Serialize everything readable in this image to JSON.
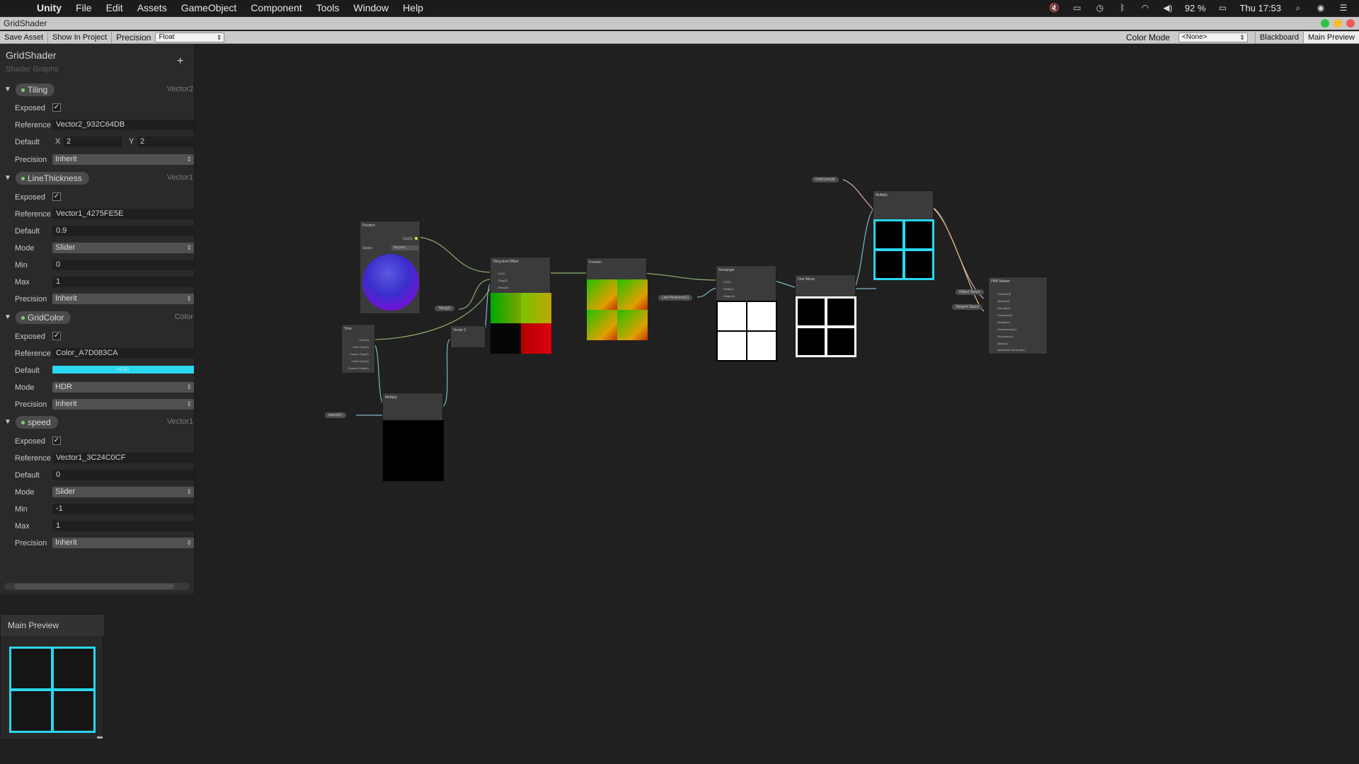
{
  "macos": {
    "app_name": "Unity",
    "menus": [
      "File",
      "Edit",
      "Assets",
      "GameObject",
      "Component",
      "Tools",
      "Window",
      "Help"
    ],
    "battery": "92 %",
    "clock": "Thu 17:53"
  },
  "window": {
    "title": "GridShader"
  },
  "toolbar": {
    "save_asset": "Save Asset",
    "show_in_project": "Show In Project",
    "precision_label": "Precision",
    "precision_value": "Float",
    "color_mode_label": "Color Mode",
    "color_mode_value": "<None>",
    "blackboard": "Blackboard",
    "main_preview": "Main Preview"
  },
  "blackboard": {
    "title": "GridShader",
    "subtitle": "Shader Graphs",
    "add_glyph": "+",
    "labels": {
      "exposed": "Exposed",
      "reference": "Reference",
      "default": "Default",
      "precision": "Precision",
      "mode": "Mode",
      "min": "Min",
      "max": "Max",
      "x": "X",
      "y": "Y"
    },
    "properties": [
      {
        "name": "Tiling",
        "type": "Vector2",
        "reference": "Vector2_932C64DB",
        "default_x": "2",
        "default_y": "2",
        "precision": "Inherit"
      },
      {
        "name": "LineThickness",
        "type": "Vector1",
        "reference": "Vector1_4275FE5E",
        "default": "0.9",
        "mode": "Slider",
        "min": "0",
        "max": "1",
        "precision": "Inherit"
      },
      {
        "name": "GridColor",
        "type": "Color",
        "reference": "Color_A7D083CA",
        "default_label": "HDR",
        "mode": "HDR",
        "precision": "Inherit"
      },
      {
        "name": "speed",
        "type": "Vector1",
        "reference": "Vector1_3C24C0CF",
        "default": "0",
        "mode": "Slider",
        "min": "-1",
        "max": "1",
        "precision": "Inherit"
      }
    ]
  },
  "main_preview": {
    "title": "Main Preview"
  },
  "graph": {
    "nodes": {
      "position": "Position",
      "position_out": "Out(3)",
      "position_space": "Space",
      "position_space_value": "Tangent",
      "time": "Time",
      "time_outputs": [
        "Time(1)",
        "Sine Time(1)",
        "Cosine Time(1)",
        "Delta Time(1)",
        "Smooth Delta(1)"
      ],
      "vector2": "Vector 2",
      "multiply_small": "Multiply",
      "tiling_offset": "Tiling And Offset",
      "tiling_offset_inputs": [
        "UV(2)",
        "Tiling(2)",
        "Offset(2)"
      ],
      "fraction": "Fraction",
      "rectangle": "Rectangle",
      "rectangle_inputs": [
        "UV(2)",
        "Width(1)",
        "Height(1)"
      ],
      "one_minus": "One Minus",
      "multiply_top": "Multiply",
      "pbr": "PBR Master",
      "pbr_inputs": [
        "Position(3)",
        "Albedo(3)",
        "Normal(3)",
        "Emission(3)",
        "Metallic(1)",
        "Smoothness(1)",
        "Occlusion(1)",
        "Alpha(1)",
        "AlphaClipThreshold(1)"
      ]
    },
    "chips": {
      "tiling": "Tiling(2)",
      "line_thickness": "LineThickness(1)",
      "speed": "speed(1)",
      "grid_color": "GridColor(4)",
      "object_space": "Object Space",
      "tangent_space": "Tangent Space"
    }
  }
}
